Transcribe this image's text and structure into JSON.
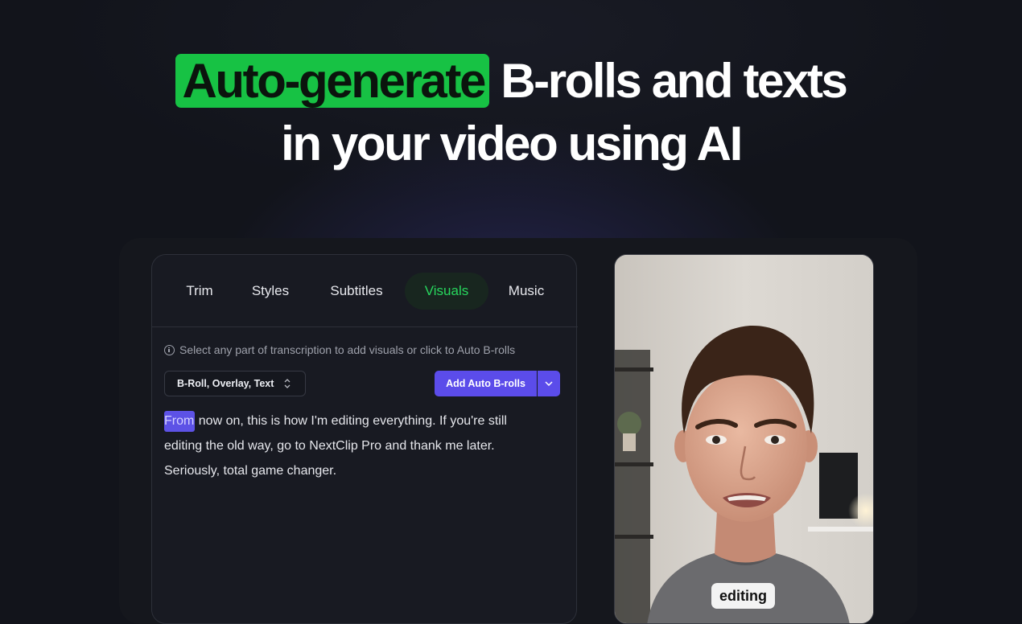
{
  "headline": {
    "highlight": "Auto-generate",
    "line1_rest": " B-rolls and texts",
    "line2": "in your video using AI"
  },
  "tabs": [
    {
      "label": "Trim",
      "active": false
    },
    {
      "label": "Styles",
      "active": false
    },
    {
      "label": "Subtitles",
      "active": false
    },
    {
      "label": "Visuals",
      "active": true
    },
    {
      "label": "Music",
      "active": false
    }
  ],
  "info_text": "Select any part of transcription to add visuals or click to Auto B-rolls",
  "type_select": {
    "value": "B-Roll, Overlay, Text"
  },
  "add_button": {
    "label": "Add Auto B-rolls"
  },
  "transcript": {
    "highlighted_word": "From",
    "text": " now on, this is how I'm editing everything. If you're still editing the old way, go to NextClip Pro and thank me later. Seriously, total game changer."
  },
  "preview": {
    "caption": "editing"
  },
  "colors": {
    "accent_green": "#17c244",
    "tab_active_text": "#27d65d",
    "primary_button": "#5b4cea",
    "background": "#12141b"
  },
  "icons": [
    "info-icon",
    "chevron-up-down-icon",
    "chevron-down-icon"
  ]
}
